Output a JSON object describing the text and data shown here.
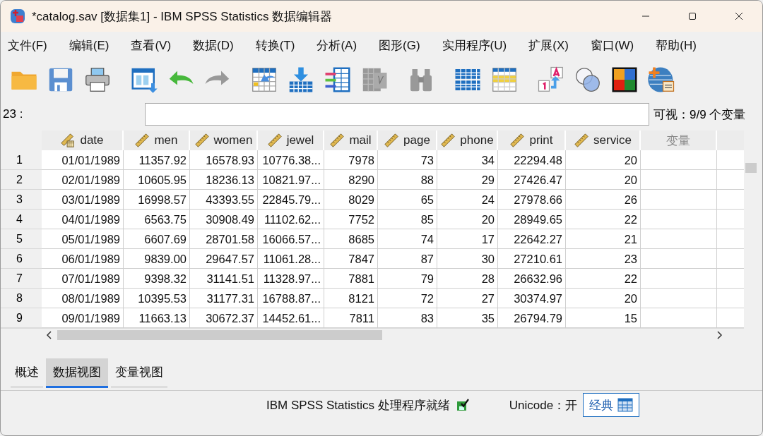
{
  "window": {
    "title": "*catalog.sav [数据集1] - IBM SPSS Statistics 数据编辑器"
  },
  "menu": [
    "文件(F)",
    "编辑(E)",
    "查看(V)",
    "数据(D)",
    "转换(T)",
    "分析(A)",
    "图形(G)",
    "实用程序(U)",
    "扩展(X)",
    "窗口(W)",
    "帮助(H)"
  ],
  "cell_editor": {
    "cell_ref": "23 :",
    "visible_info": "可视：9/9 个变量"
  },
  "table": {
    "columns": [
      {
        "label": "date",
        "kind": "date"
      },
      {
        "label": "men",
        "kind": "scale"
      },
      {
        "label": "women",
        "kind": "scale"
      },
      {
        "label": "jewel",
        "kind": "scale"
      },
      {
        "label": "mail",
        "kind": "scale"
      },
      {
        "label": "page",
        "kind": "scale"
      },
      {
        "label": "phone",
        "kind": "scale"
      },
      {
        "label": "print",
        "kind": "scale"
      },
      {
        "label": "service",
        "kind": "scale"
      },
      {
        "label": "变量",
        "kind": "empty"
      }
    ],
    "rows": [
      {
        "num": "1",
        "cells": [
          "01/01/1989",
          "11357.92",
          "16578.93",
          "10776.38...",
          "7978",
          "73",
          "34",
          "22294.48",
          "20"
        ]
      },
      {
        "num": "2",
        "cells": [
          "02/01/1989",
          "10605.95",
          "18236.13",
          "10821.97...",
          "8290",
          "88",
          "29",
          "27426.47",
          "20"
        ]
      },
      {
        "num": "3",
        "cells": [
          "03/01/1989",
          "16998.57",
          "43393.55",
          "22845.79...",
          "8029",
          "65",
          "24",
          "27978.66",
          "26"
        ]
      },
      {
        "num": "4",
        "cells": [
          "04/01/1989",
          "6563.75",
          "30908.49",
          "11102.62...",
          "7752",
          "85",
          "20",
          "28949.65",
          "22"
        ]
      },
      {
        "num": "5",
        "cells": [
          "05/01/1989",
          "6607.69",
          "28701.58",
          "16066.57...",
          "8685",
          "74",
          "17",
          "22642.27",
          "21"
        ]
      },
      {
        "num": "6",
        "cells": [
          "06/01/1989",
          "9839.00",
          "29647.57",
          "11061.28...",
          "7847",
          "87",
          "30",
          "27210.61",
          "23"
        ]
      },
      {
        "num": "7",
        "cells": [
          "07/01/1989",
          "9398.32",
          "31141.51",
          "11328.97...",
          "7881",
          "79",
          "28",
          "26632.96",
          "22"
        ]
      },
      {
        "num": "8",
        "cells": [
          "08/01/1989",
          "10395.53",
          "31177.31",
          "16788.87...",
          "8121",
          "72",
          "27",
          "30374.97",
          "20"
        ]
      },
      {
        "num": "9",
        "cells": [
          "09/01/1989",
          "11663.13",
          "30672.37",
          "14452.61...",
          "7811",
          "83",
          "35",
          "26794.79",
          "15"
        ]
      }
    ]
  },
  "tabs": [
    {
      "label": "概述",
      "selected": false
    },
    {
      "label": "数据视图",
      "selected": true
    },
    {
      "label": "变量视图",
      "selected": false
    }
  ],
  "status_bar": {
    "processor": "IBM SPSS Statistics 处理程序就绪",
    "unicode": "Unicode：开",
    "mode_button": "经典"
  }
}
